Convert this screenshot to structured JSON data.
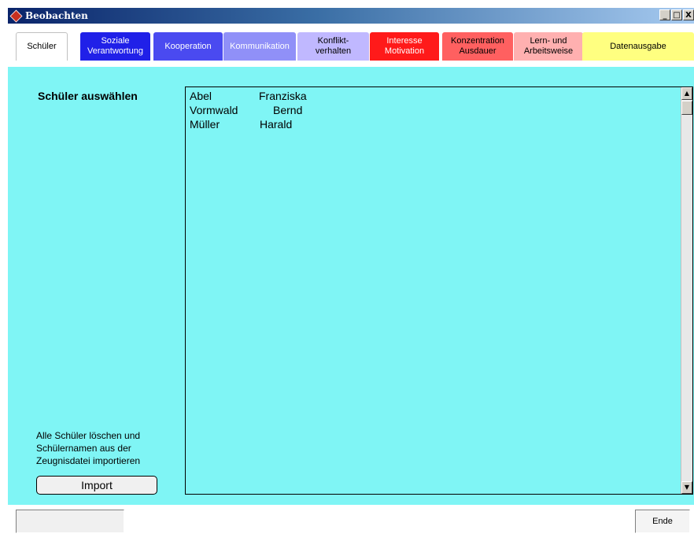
{
  "window": {
    "title": "Beobachten",
    "buttons": [
      "_",
      "□",
      "X"
    ]
  },
  "tabs": [
    {
      "label": "Schüler",
      "bg": "#ffffff",
      "fg": "#000000",
      "active": true
    },
    {
      "label": "Soziale\nVerantwortung",
      "bg": "#2020e8",
      "fg": "#ffffff"
    },
    {
      "label": "Kooperation",
      "bg": "#4a4af0",
      "fg": "#ffffff"
    },
    {
      "label": "Kommunikation",
      "bg": "#9090f8",
      "fg": "#ffffff"
    },
    {
      "label": "Konflikt-\nverhalten",
      "bg": "#c0b8ff",
      "fg": "#000000"
    },
    {
      "label": "Interesse\nMotivation",
      "bg": "#ff1a1a",
      "fg": "#ffffff"
    },
    {
      "label": "Konzentration\nAusdauer",
      "bg": "#ff6060",
      "fg": "#000000"
    },
    {
      "label": "Lern- und\nArbeitsweise",
      "bg": "#ffb0b0",
      "fg": "#000000"
    },
    {
      "label": "Datenausgabe",
      "bg": "#ffff80",
      "fg": "#000000"
    }
  ],
  "main": {
    "heading": "Schüler auswählen",
    "students": [
      {
        "last": "Abel",
        "first": "Franziska"
      },
      {
        "last": "Vormwald",
        "first": "Bernd"
      },
      {
        "last": "Müller",
        "first": "Harald"
      }
    ],
    "import_info": "Alle Schüler löschen und Schülernamen aus der Zeugnisdatei importieren",
    "import_button": "Import"
  },
  "footer": {
    "status": "",
    "end_button": "Ende"
  },
  "colors": {
    "content_bg": "#7ff5f5"
  }
}
